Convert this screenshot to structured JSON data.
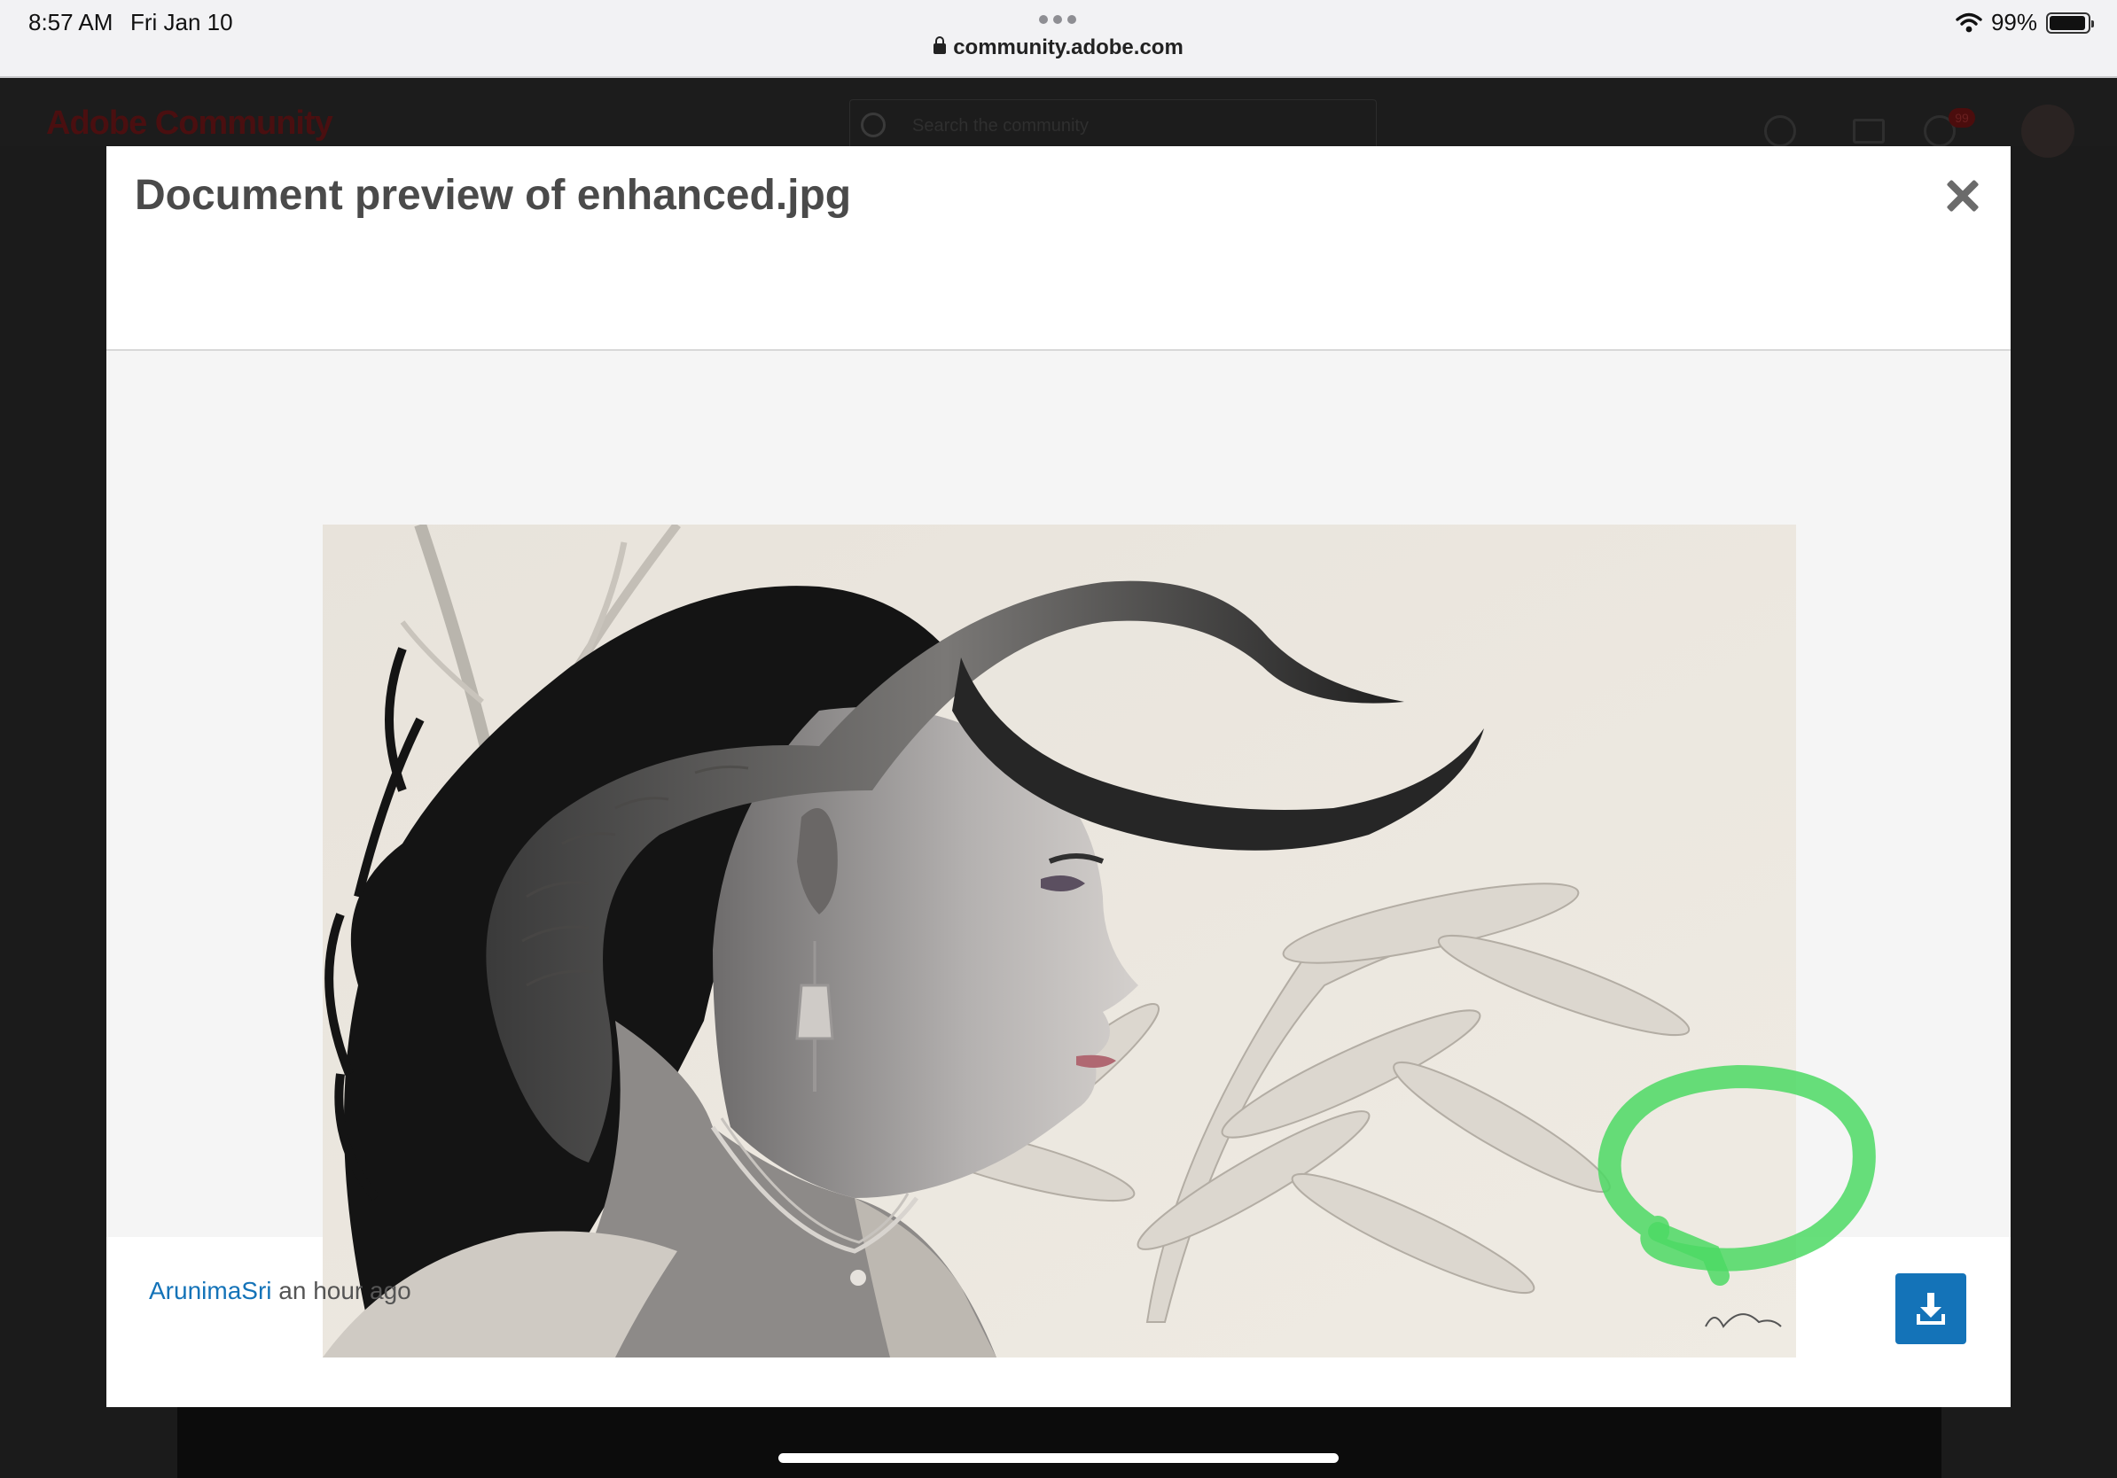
{
  "status_bar": {
    "time": "8:57 AM",
    "date": "Fri Jan 10",
    "url": "community.adobe.com",
    "battery": "99%",
    "battery_level": 0.99
  },
  "background_site": {
    "logo": "Adobe Community",
    "search_placeholder": "Search the community",
    "notification_count": "99"
  },
  "modal": {
    "title": "Document preview of enhanced.jpg",
    "image_alt": "enhanced.jpg",
    "author": "ArunimaSri",
    "posted": "an hour ago",
    "download_icon": "download-icon",
    "close_icon": "close-icon"
  },
  "colors": {
    "link": "#1473b8",
    "button": "#1473b8",
    "annotation": "#4cd964"
  }
}
